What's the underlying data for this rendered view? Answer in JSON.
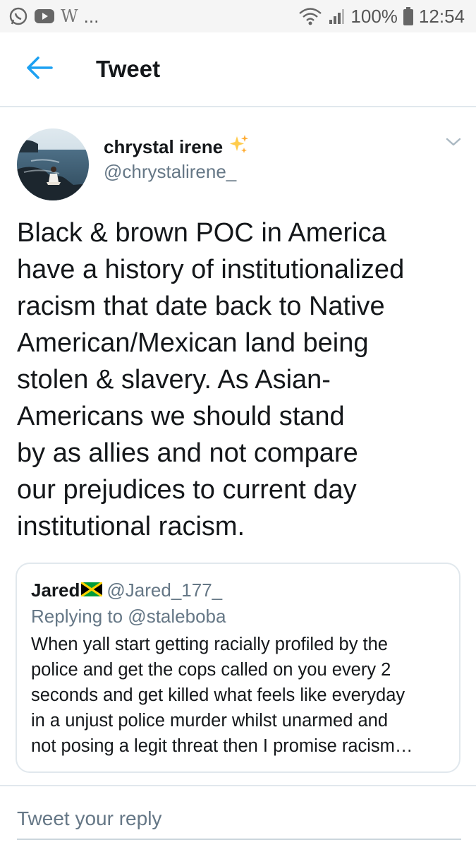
{
  "status_bar": {
    "left_glyph": "W",
    "left_ellipsis": "...",
    "battery": "100%",
    "time": "12:54",
    "icons": [
      "whatsapp-icon",
      "youtube-icon",
      "wifi-icon",
      "signal-icon",
      "battery-icon"
    ]
  },
  "header": {
    "title": "Tweet",
    "back_icon": "arrow-left-icon"
  },
  "tweet": {
    "author_name": "chrystal irene",
    "author_emoji": "sparkles-icon",
    "author_handle": "@chrystalirene_",
    "text_lines": [
      "Black & brown POC in America",
      "have a history of institutionalized",
      "racism that date back to Native",
      "American/Mexican land being",
      "stolen & slavery. As Asian-",
      "Americans we should stand",
      "by as allies and not compare",
      "our prejudices to current day",
      "institutional racism."
    ]
  },
  "quoted_tweet": {
    "name": "Jared",
    "flag": "jamaica-flag-icon",
    "handle": "@Jared_177_",
    "replying_to": "Replying to @staleboba",
    "text_lines": [
      "When yall start getting racially profiled by the",
      "police and get the cops called on you every 2",
      "seconds and get killed what feels like everyday",
      "in a unjust police murder whilst unarmed and",
      "not posing a legit threat then I promise racism…"
    ]
  },
  "reply": {
    "placeholder": "Tweet your reply"
  },
  "colors": {
    "accent": "#1da1f2",
    "text": "#14171a",
    "secondary": "#657786",
    "border": "#e1e8ed"
  }
}
